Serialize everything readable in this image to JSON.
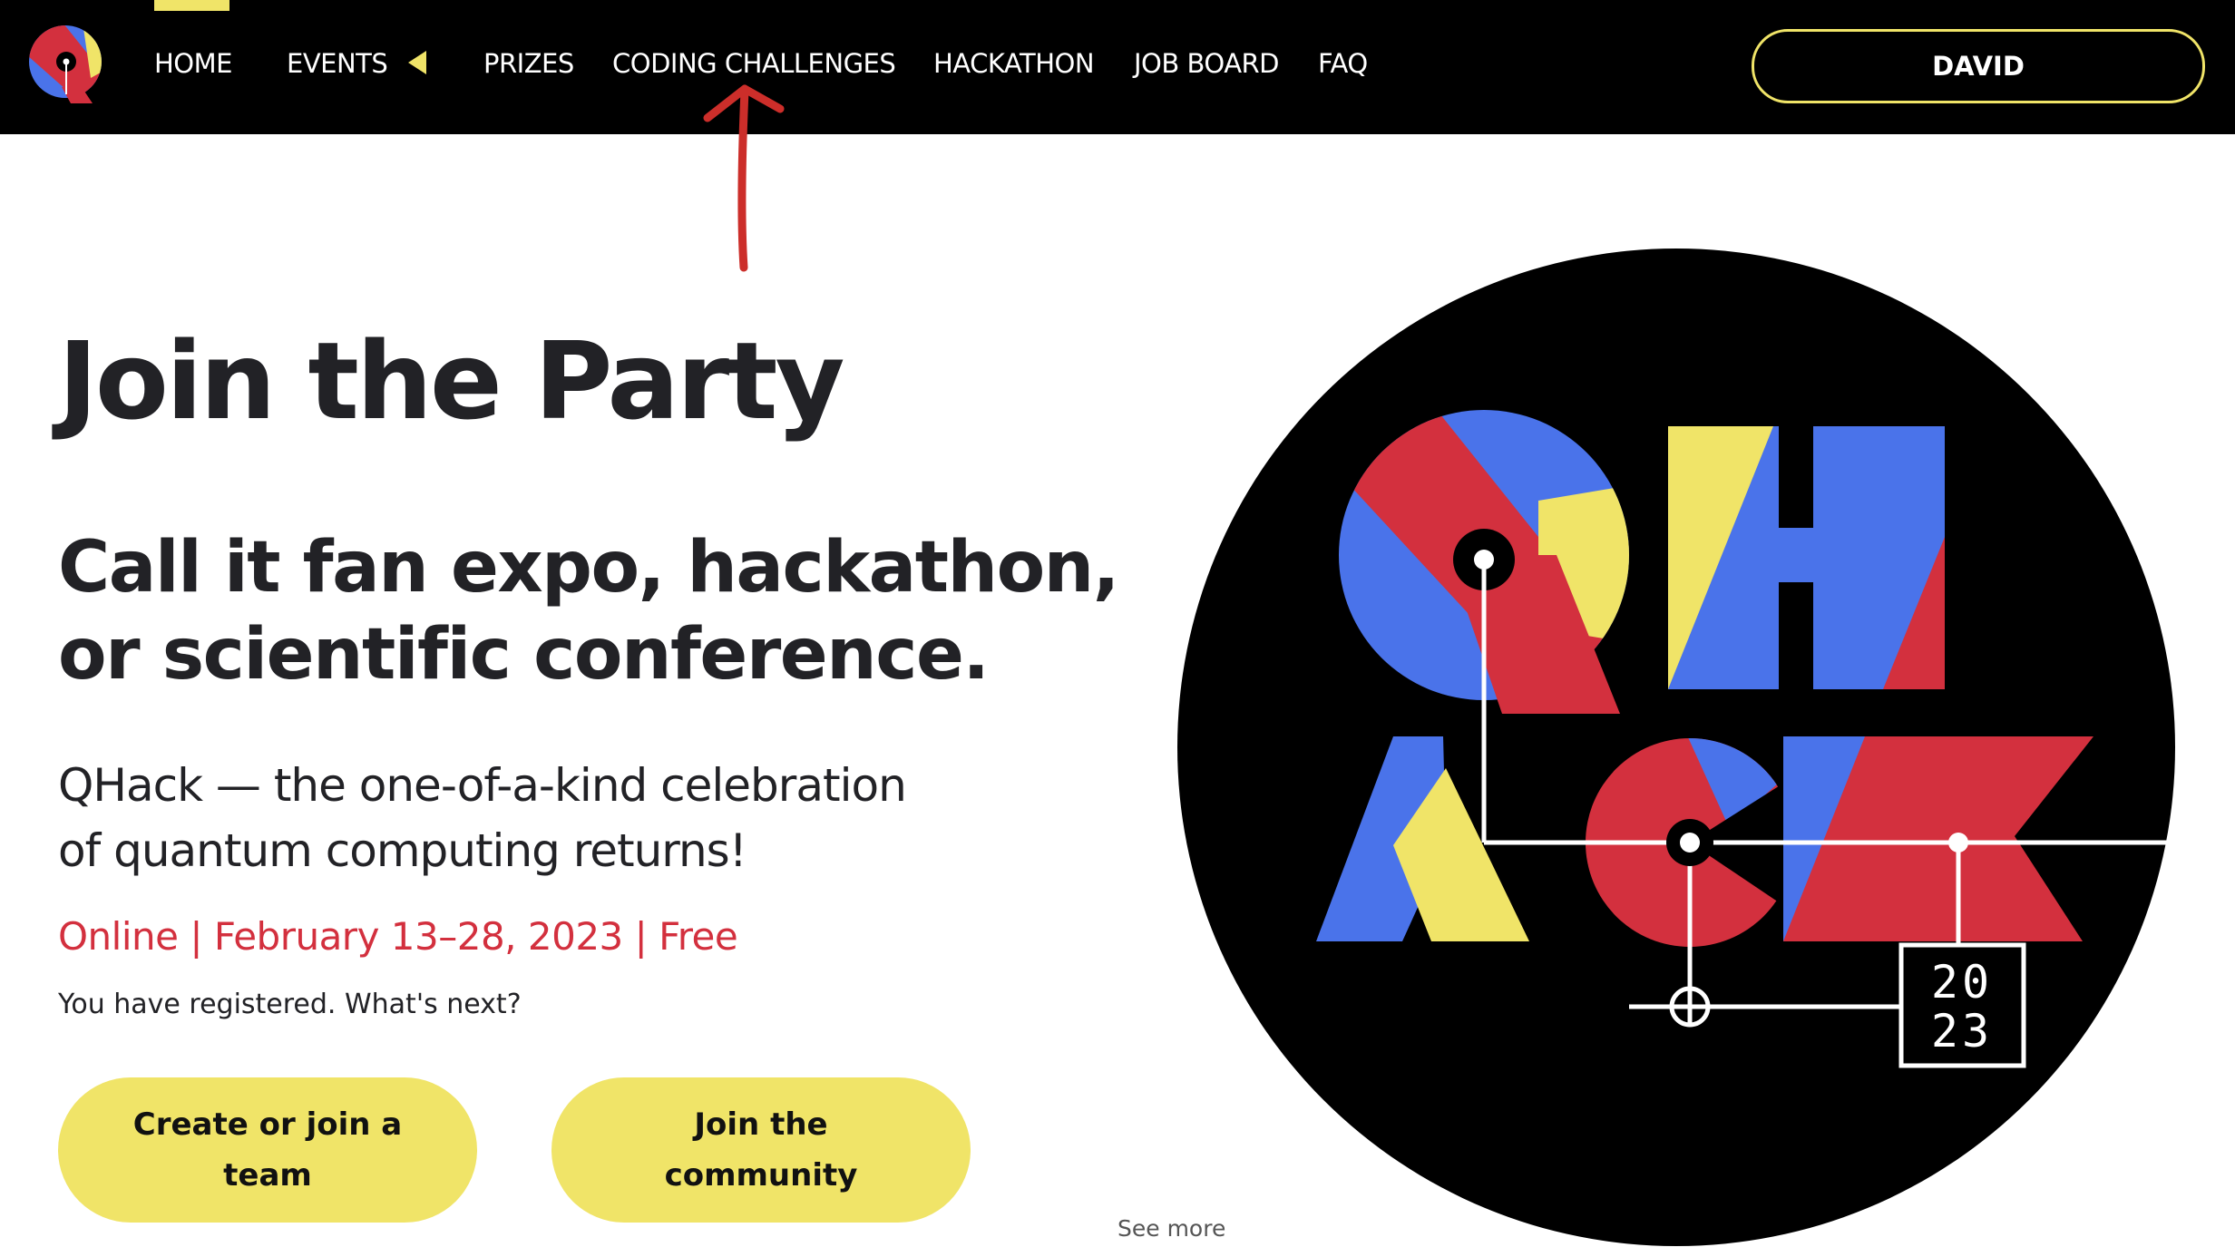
{
  "nav": {
    "items": [
      {
        "label": "HOME"
      },
      {
        "label": "EVENTS"
      },
      {
        "label": "PRIZES"
      },
      {
        "label": "CODING CHALLENGES"
      },
      {
        "label": "HACKATHON"
      },
      {
        "label": "JOB BOARD"
      },
      {
        "label": "FAQ"
      }
    ],
    "user_label": "DAVID"
  },
  "hero": {
    "title": "Join the Party",
    "subtitle_line1": "Call it fan expo, hackathon,",
    "subtitle_line2": "or scientific conference.",
    "description_line1": "QHack — the one-of-a-kind celebration",
    "description_line2": "of quantum computing returns!",
    "event_info": "Online | February 13–28, 2023 | Free",
    "registration_note": "You have registered. What's next?",
    "buttons": [
      {
        "label": "Create or join a team"
      },
      {
        "label": "Join the community"
      }
    ],
    "see_more": "See more"
  },
  "badge": {
    "year_top": "20",
    "year_bottom": "23"
  },
  "colors": {
    "accent_yellow": "#f0e468",
    "accent_red": "#d3303e",
    "accent_blue": "#4a73ea",
    "nav_background": "#000000",
    "annotation_arrow": "#cc2e2a"
  }
}
